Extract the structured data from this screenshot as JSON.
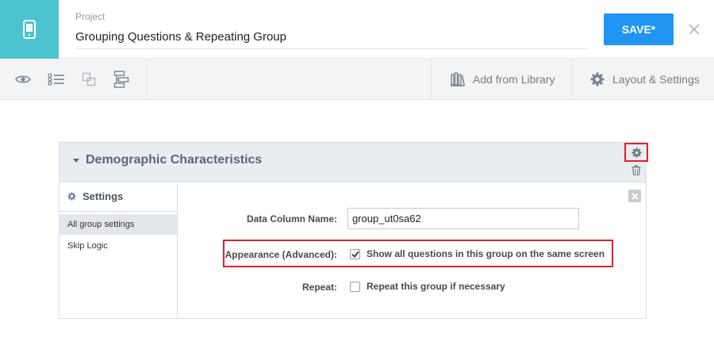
{
  "header": {
    "project_label": "Project",
    "project_name": "Grouping Questions & Repeating Group",
    "save_label": "SAVE*",
    "logo_icon": "mobile-form-icon",
    "close_icon": "close-icon"
  },
  "toolbar": {
    "icons": [
      "preview-eye-icon",
      "question-list-icon",
      "copy-icon",
      "hierarchy-icon"
    ],
    "add_from_library": "Add from Library",
    "layout_settings": "Layout & Settings"
  },
  "group": {
    "title": "Demographic Characteristics",
    "sidebar": {
      "heading": "Settings",
      "items": [
        {
          "label": "All group settings",
          "active": true
        },
        {
          "label": "Skip Logic",
          "active": false
        }
      ]
    },
    "fields": {
      "data_column_label": "Data Column Name:",
      "data_column_value": "group_ut0sa62",
      "appearance_label": "Appearance (Advanced):",
      "appearance_option": "Show all questions in this group on the same screen",
      "appearance_checked": true,
      "repeat_label": "Repeat:",
      "repeat_option": "Repeat this group if necessary",
      "repeat_checked": false
    }
  },
  "colors": {
    "brand_teal": "#4ec3d0",
    "save_blue": "#2095f2",
    "highlight_red": "#e02030"
  }
}
